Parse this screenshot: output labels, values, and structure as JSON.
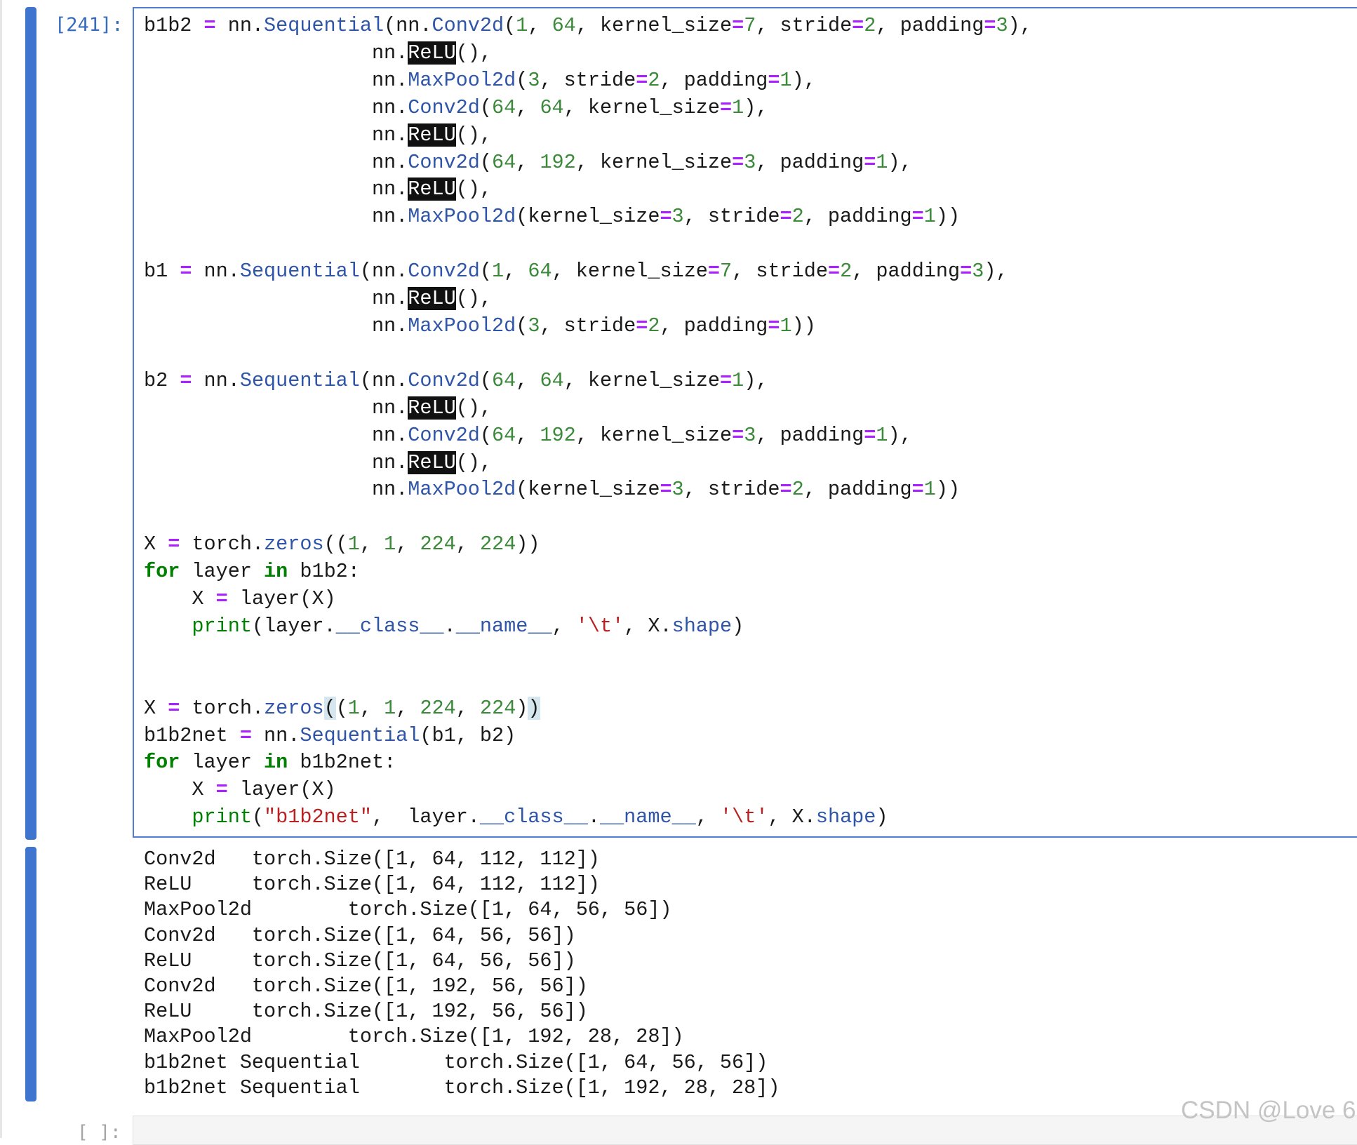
{
  "cell": {
    "execution_count": "[241]:",
    "code_lines": [
      "b1b2 = nn.Sequential(nn.Conv2d(1, 64, kernel_size=7, stride=2, padding=3),",
      "                   nn.ReLU(),",
      "                   nn.MaxPool2d(3, stride=2, padding=1),",
      "                   nn.Conv2d(64, 64, kernel_size=1),",
      "                   nn.ReLU(),",
      "                   nn.Conv2d(64, 192, kernel_size=3, padding=1),",
      "                   nn.ReLU(),",
      "                   nn.MaxPool2d(kernel_size=3, stride=2, padding=1))",
      "",
      "b1 = nn.Sequential(nn.Conv2d(1, 64, kernel_size=7, stride=2, padding=3),",
      "                   nn.ReLU(),",
      "                   nn.MaxPool2d(3, stride=2, padding=1))",
      "",
      "b2 = nn.Sequential(nn.Conv2d(64, 64, kernel_size=1),",
      "                   nn.ReLU(),",
      "                   nn.Conv2d(64, 192, kernel_size=3, padding=1),",
      "                   nn.ReLU(),",
      "                   nn.MaxPool2d(kernel_size=3, stride=2, padding=1))",
      "",
      "X = torch.zeros((1, 1, 224, 224))",
      "for layer in b1b2:",
      "    X = layer(X)",
      "    print(layer.__class__.__name__, '\\t', X.shape)",
      "",
      "",
      "X = torch.zeros((1, 1, 224, 224))",
      "b1b2net = nn.Sequential(b1, b2)",
      "for layer in b1b2net:",
      "    X = layer(X)",
      "    print(\"b1b2net\",  layer.__class__.__name__, '\\t', X.shape)"
    ],
    "output_lines": [
      "Conv2d\t torch.Size([1, 64, 112, 112])",
      "ReLU\t torch.Size([1, 64, 112, 112])",
      "MaxPool2d\t torch.Size([1, 64, 56, 56])",
      "Conv2d\t torch.Size([1, 64, 56, 56])",
      "ReLU\t torch.Size([1, 64, 56, 56])",
      "Conv2d\t torch.Size([1, 192, 56, 56])",
      "ReLU\t torch.Size([1, 192, 56, 56])",
      "MaxPool2d\t torch.Size([1, 192, 28, 28])",
      "b1b2net Sequential\t torch.Size([1, 64, 56, 56])",
      "b1b2net Sequential\t torch.Size([1, 192, 28, 28])"
    ]
  },
  "next_cell": {
    "prompt": "[ ]:"
  },
  "watermark": "CSDN @Love 6",
  "colors": {
    "cell_bar": "#3f74cf",
    "editor_border": "#4f7dd4",
    "prompt": "#366cbd",
    "keyword": "#008000",
    "operator": "#aa22ff",
    "number": "#3a8a3a",
    "attribute": "#2f55a8",
    "string": "#ba2121",
    "selection_highlight": "#111111"
  }
}
